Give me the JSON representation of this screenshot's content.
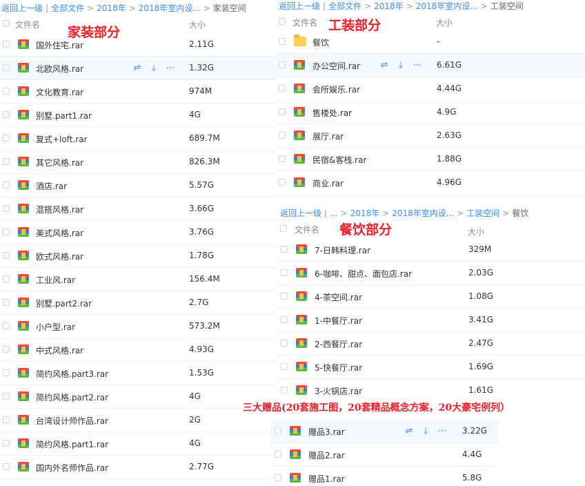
{
  "home": {
    "breadcrumb": [
      "返回上一级",
      "全部文件",
      "2018年",
      "2018年室内设...",
      "家装空间"
    ],
    "title": "家装部分",
    "col_name": "文件名",
    "col_size": "大小",
    "rows": [
      {
        "name": "国外住宅.rar",
        "size": "2.11G"
      },
      {
        "name": "北欧风格.rar",
        "size": "1.32G"
      },
      {
        "name": "文化教育.rar",
        "size": "974M"
      },
      {
        "name": "别墅.part1.rar",
        "size": "4G"
      },
      {
        "name": "复式+loft.rar",
        "size": "689.7M"
      },
      {
        "name": "其它风格.rar",
        "size": "826.3M"
      },
      {
        "name": "酒店.rar",
        "size": "5.57G"
      },
      {
        "name": "混搭风格.rar",
        "size": "3.66G"
      },
      {
        "name": "美式风格.rar",
        "size": "3.76G"
      },
      {
        "name": "欧式风格.rar",
        "size": "1.78G"
      },
      {
        "name": "工业风.rar",
        "size": "156.4M"
      },
      {
        "name": "别墅.part2.rar",
        "size": "2.7G"
      },
      {
        "name": "小户型.rar",
        "size": "573.2M"
      },
      {
        "name": "中式风格.rar",
        "size": "4.93G"
      },
      {
        "name": "简约风格.part3.rar",
        "size": "1.53G"
      },
      {
        "name": "简约风格.part2.rar",
        "size": "4G"
      },
      {
        "name": "台湾设计师作品.rar",
        "size": "2G"
      },
      {
        "name": "简约风格.part1.rar",
        "size": "4G"
      },
      {
        "name": "国内外名师作品.rar",
        "size": "2.77G"
      }
    ]
  },
  "work": {
    "breadcrumb": [
      "返回上一级",
      "全部文件",
      "2018年",
      "2018年室内设...",
      "工装空间"
    ],
    "title": "工装部分",
    "col_name": "文件名",
    "col_size": "大小",
    "rows": [
      {
        "name": "餐饮",
        "size": "-"
      },
      {
        "name": "办公空间.rar",
        "size": "6.61G"
      },
      {
        "name": "会所娱乐.rar",
        "size": "4.44G"
      },
      {
        "name": "售楼处.rar",
        "size": "4.9G"
      },
      {
        "name": "展厅.rar",
        "size": "2.63G"
      },
      {
        "name": "民宿&客栈.rar",
        "size": "1.88G"
      },
      {
        "name": "商业.rar",
        "size": "4.96G"
      }
    ]
  },
  "dining": {
    "breadcrumb": [
      "返回上一级",
      "...",
      "2018年",
      "2018年室内设...",
      "工装空间",
      "餐饮"
    ],
    "title": "餐饮部分",
    "col_name": "文件名",
    "col_size": "大小",
    "rows": [
      {
        "name": "7-日韩料理.rar",
        "size": "329M"
      },
      {
        "name": "6-咖啡、甜点、面包店.rar",
        "size": "2.03G"
      },
      {
        "name": "4-茶空间.rar",
        "size": "1.08G"
      },
      {
        "name": "1-中餐厅.rar",
        "size": "3.41G"
      },
      {
        "name": "2-西餐厅.rar",
        "size": "2.47G"
      },
      {
        "name": "5-快餐厅.rar",
        "size": "1.69G"
      },
      {
        "name": "3-火锅店.rar",
        "size": "1.61G"
      }
    ]
  },
  "gifts": {
    "banner": "三大赠品(20套施工图，20套精品概念方案，20大豪宅例列）",
    "rows": [
      {
        "name": "赠品3.rar",
        "size": "3.22G"
      },
      {
        "name": "赠品2.rar",
        "size": "4.4G"
      },
      {
        "name": "赠品1.rar",
        "size": "5.8G"
      }
    ]
  },
  "actions": {
    "share": "share-icon",
    "download": "download-icon",
    "more": "more-icon"
  }
}
